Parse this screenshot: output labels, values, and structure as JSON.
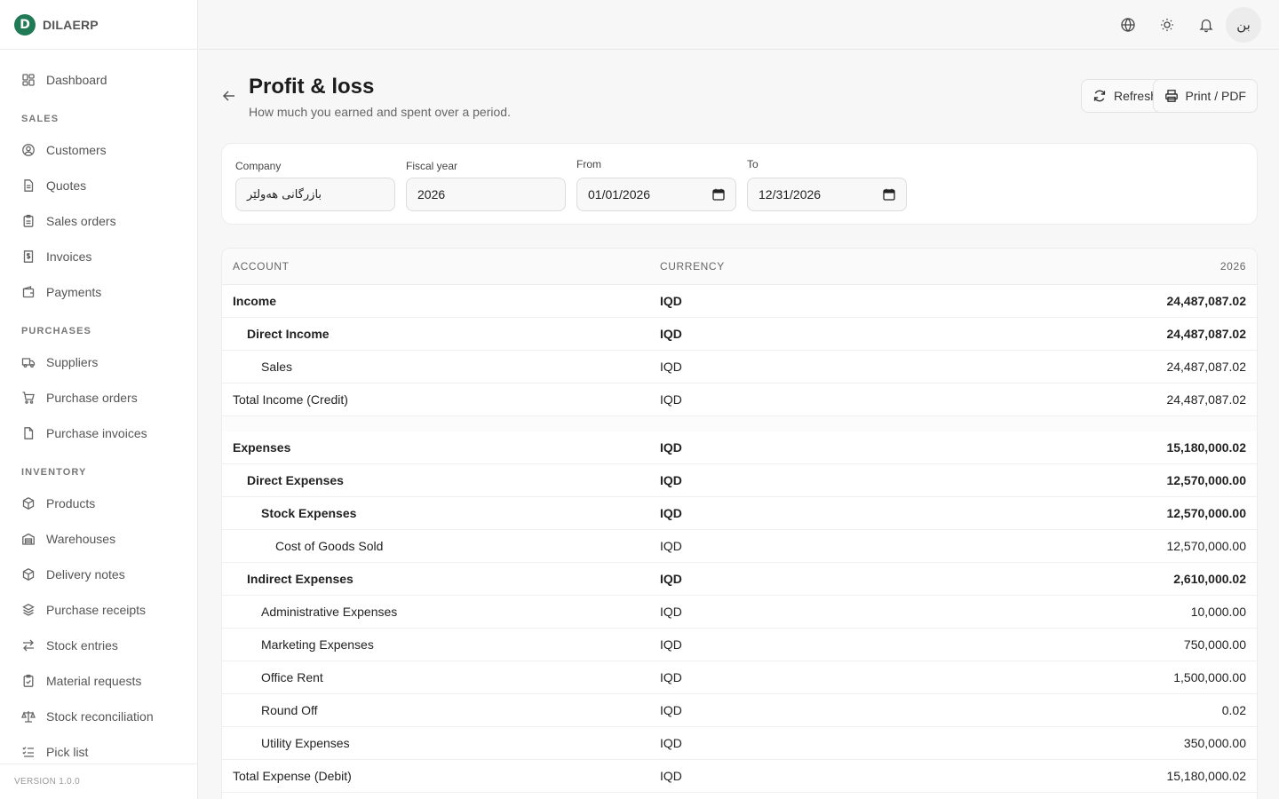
{
  "brand": {
    "name": "DILAERP",
    "logo_letter": "D"
  },
  "sidebar": {
    "dashboard": "Dashboard",
    "sections": [
      {
        "title": "SALES",
        "items": [
          "Customers",
          "Quotes",
          "Sales orders",
          "Invoices",
          "Payments"
        ]
      },
      {
        "title": "PURCHASES",
        "items": [
          "Suppliers",
          "Purchase orders",
          "Purchase invoices"
        ]
      },
      {
        "title": "INVENTORY",
        "items": [
          "Products",
          "Warehouses",
          "Delivery notes",
          "Purchase receipts",
          "Stock entries",
          "Material requests",
          "Stock reconciliation",
          "Pick list"
        ]
      }
    ],
    "version": "VERSION 1.0.0"
  },
  "topbar": {
    "avatar": "بن",
    "icons": [
      "globe-icon",
      "sun-icon",
      "bell-icon"
    ]
  },
  "page": {
    "title": "Profit & loss",
    "subtitle": "How much you earned and spent over a period.",
    "refresh_label": "Refresh",
    "print_label": "Print / PDF"
  },
  "filters": {
    "company_label": "Company",
    "company_value": "بازرگانی هەولێر",
    "fiscal_label": "Fiscal year",
    "fiscal_value": "2026",
    "from_label": "From",
    "from_value": "01/01/2026",
    "to_label": "To",
    "to_value": "12/31/2026"
  },
  "table": {
    "headers": {
      "account": "ACCOUNT",
      "currency": "CURRENCY",
      "period": "2026"
    },
    "rows": [
      {
        "account": "Income",
        "currency": "IQD",
        "value": "24,487,087.02",
        "level": 0,
        "bold": true
      },
      {
        "account": "Direct Income",
        "currency": "IQD",
        "value": "24,487,087.02",
        "level": 1,
        "bold": true
      },
      {
        "account": "Sales",
        "currency": "IQD",
        "value": "24,487,087.02",
        "level": 2,
        "bold": false
      },
      {
        "account": "Total Income (Credit)",
        "currency": "IQD",
        "value": "24,487,087.02",
        "level": 0,
        "bold": false
      },
      {
        "spacer": true
      },
      {
        "account": "Expenses",
        "currency": "IQD",
        "value": "15,180,000.02",
        "level": 0,
        "bold": true
      },
      {
        "account": "Direct Expenses",
        "currency": "IQD",
        "value": "12,570,000.00",
        "level": 1,
        "bold": true
      },
      {
        "account": "Stock Expenses",
        "currency": "IQD",
        "value": "12,570,000.00",
        "level": 2,
        "bold": true
      },
      {
        "account": "Cost of Goods Sold",
        "currency": "IQD",
        "value": "12,570,000.00",
        "level": 3,
        "bold": false
      },
      {
        "account": "Indirect Expenses",
        "currency": "IQD",
        "value": "2,610,000.02",
        "level": 1,
        "bold": true
      },
      {
        "account": "Administrative Expenses",
        "currency": "IQD",
        "value": "10,000.00",
        "level": 2,
        "bold": false
      },
      {
        "account": "Marketing Expenses",
        "currency": "IQD",
        "value": "750,000.00",
        "level": 2,
        "bold": false
      },
      {
        "account": "Office Rent",
        "currency": "IQD",
        "value": "1,500,000.00",
        "level": 2,
        "bold": false
      },
      {
        "account": "Round Off",
        "currency": "IQD",
        "value": "0.02",
        "level": 2,
        "bold": false
      },
      {
        "account": "Utility Expenses",
        "currency": "IQD",
        "value": "350,000.00",
        "level": 2,
        "bold": false
      },
      {
        "account": "Total Expense (Debit)",
        "currency": "IQD",
        "value": "15,180,000.02",
        "level": 0,
        "bold": false
      }
    ]
  }
}
